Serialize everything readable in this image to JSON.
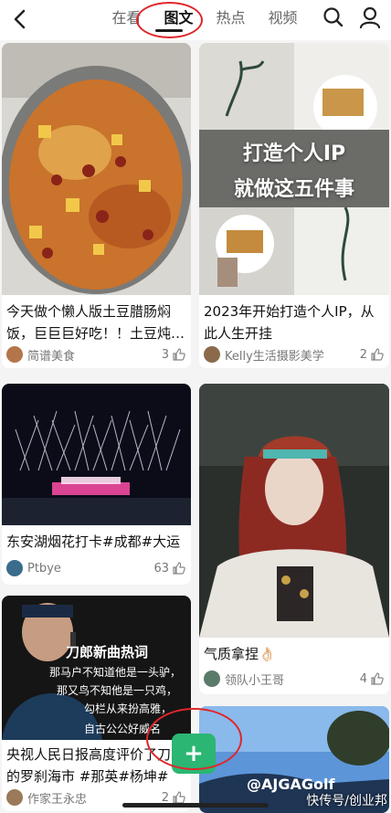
{
  "nav": {
    "tabs": [
      {
        "label": "在看"
      },
      {
        "label": "图文"
      },
      {
        "label": "热点"
      },
      {
        "label": "视频"
      }
    ],
    "active_tab": "图文"
  },
  "feed": [
    {
      "title": "今天做个懒人版土豆腊肠焖饭，巨巨巨好吃！！土豆炖…",
      "author": "简谱美食",
      "likes": "3"
    },
    {
      "title": "2023年开始打造个人IP，从此人生开挂",
      "overlay_text_line1": "打造个人IP",
      "overlay_text_line2": "就做这五件事",
      "author": "Kelly生活摄影美学",
      "likes": "2"
    },
    {
      "title": "东安湖烟花打卡#成都#大运会",
      "author": "Ptbye",
      "likes": "63"
    },
    {
      "title": "气质拿捏👌🏻",
      "author": "领队小王哥",
      "likes": "4"
    },
    {
      "title": "央视人民日报高度评价了刀郎的罗刹海市 #那英#杨坤#高…",
      "overlay_line1": "刀郎新曲热词",
      "overlay_line2": "那马户不知道他是一头驴，",
      "overlay_line3": "那又鸟不知他是一只鸡，",
      "overlay_line4": "勾栏从来扮高雅，",
      "overlay_line5": "自古公公好威名",
      "author": "作家王永忠",
      "likes": "2"
    },
    {
      "overlay_text": "@AJGAGolf"
    }
  ],
  "fab": {
    "label": "+"
  },
  "watermark": "快传号/创业邦"
}
